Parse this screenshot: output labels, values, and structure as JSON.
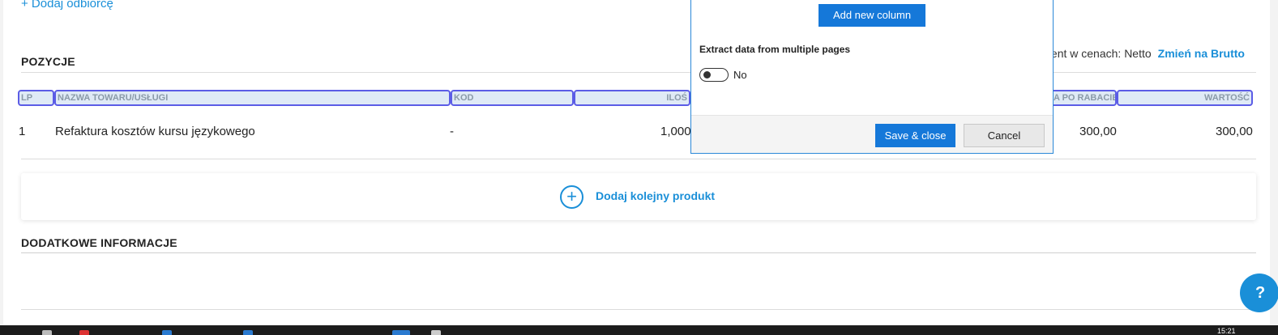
{
  "form": {
    "add_recipient": "+ Dodaj odbiorcę",
    "positions_title": "POZYCJE",
    "price_mode_label": "ment w cenach: Netto",
    "price_mode_link": "Zmień na Brutto",
    "additional_title": "DODATKOWE INFORMACJE"
  },
  "table": {
    "headers": [
      "LP",
      "NAZWA TOWARU/USŁUGI",
      "KOD",
      "ILOŚ",
      "A PO RABACIE",
      "WARTOŚĆ"
    ],
    "rows": [
      {
        "lp": "1",
        "name": "Refaktura kosztów kursu językowego",
        "code": "-",
        "qty": "1,000",
        "price_after_discount": "300,00",
        "value": "300,00"
      }
    ]
  },
  "add_product": {
    "icon": "plus-circle-icon",
    "label": "Dodaj kolejny produkt"
  },
  "help": {
    "label": "?"
  },
  "dialog": {
    "add_column": "Add new column",
    "extract_label": "Extract data from multiple pages",
    "toggle_value": "No",
    "save": "Save & close",
    "cancel": "Cancel"
  },
  "taskbar": {
    "clock": "15:21"
  },
  "colors": {
    "accent": "#1a8fd8",
    "button": "#1578d9",
    "header_outline": "#5b5ce6",
    "header_bg": "#dfeaf6"
  }
}
